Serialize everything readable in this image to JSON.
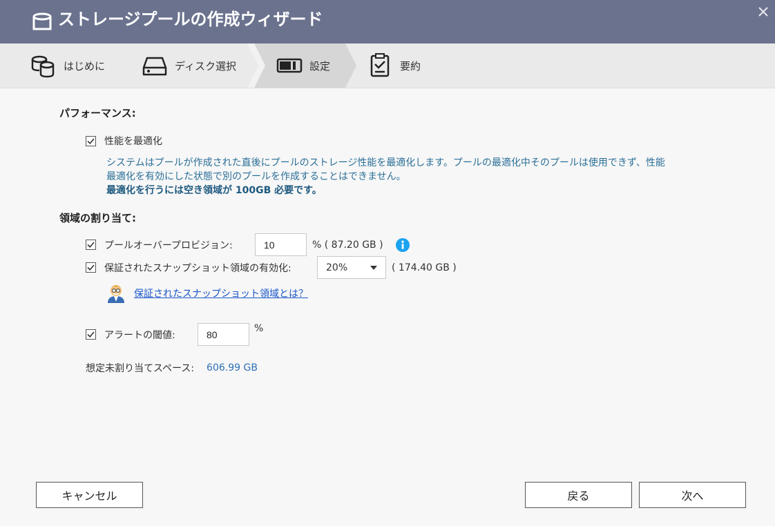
{
  "window": {
    "title": "ストレージプールの作成ウィザード",
    "app_icon": "storage-drum-icon",
    "close_icon": "close-icon"
  },
  "steps": [
    {
      "label": "はじめに",
      "icon": "database-stack-icon",
      "active": false
    },
    {
      "label": "ディスク選択",
      "icon": "hard-drive-icon",
      "active": false
    },
    {
      "label": "設定",
      "icon": "storage-bar-icon",
      "active": true
    },
    {
      "label": "要約",
      "icon": "clipboard-check-icon",
      "active": false
    }
  ],
  "performance": {
    "heading": "パフォーマンス:",
    "optimize_label": "性能を最適化",
    "optimize_checked": true,
    "description_line1": "システムはプールが作成された直後にプールのストレージ性能を最適化します。プールの最適化中そのプールは使用できず、性能",
    "description_line2": "最適化を有効にした状態で別のプールを作成することはできません。",
    "description_note": "最適化を行うには空き領域が 100GB 必要です。"
  },
  "allocation": {
    "heading": "領域の割り当て:",
    "overprovision": {
      "label": "プールオーバープロビジョン:",
      "checked": true,
      "value": "10",
      "suffix": "% ( 87.20 GB )",
      "info_icon": "info-icon"
    },
    "snapshot": {
      "label": "保証されたスナップショット領域の有効化:",
      "checked": true,
      "selected": "20%",
      "suffix": "( 174.40 GB )"
    },
    "help_link": "保証されたスナップショット領域とは？",
    "mascot_icon": "helper-mascot-icon",
    "alert": {
      "label": "アラートの閾値:",
      "checked": true,
      "value": "80",
      "suffix": "%"
    },
    "unallocated": {
      "label": "想定未割り当てスペース:",
      "value": "606.99 GB"
    }
  },
  "buttons": {
    "cancel": "キャンセル",
    "back": "戻る",
    "next": "次へ"
  },
  "colors": {
    "titlebar": "#6b728e",
    "description": "#2a6f97",
    "link": "#1a56c8",
    "info": "#1aa3f0"
  }
}
